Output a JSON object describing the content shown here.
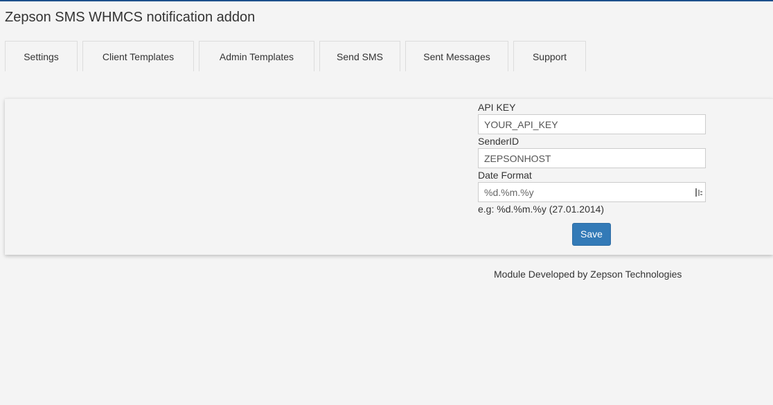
{
  "page": {
    "title": "Zepson SMS WHMCS notification addon"
  },
  "tabs": [
    {
      "label": "Settings"
    },
    {
      "label": "Client Templates"
    },
    {
      "label": "Admin Templates"
    },
    {
      "label": "Send SMS"
    },
    {
      "label": "Sent Messages"
    },
    {
      "label": "Support"
    }
  ],
  "form": {
    "api_key": {
      "label": "API KEY",
      "value": "YOUR_API_KEY"
    },
    "sender_id": {
      "label": "SenderID",
      "value": "ZEPSONHOST"
    },
    "date_format": {
      "label": "Date Format",
      "value": "%d.%m.%y",
      "icon": "input-format-icon"
    },
    "hint": "e.g: %d.%m.%y (27.01.2014)",
    "save_label": "Save"
  },
  "footer": {
    "text": "Module Developed by Zepson Technologies"
  },
  "colors": {
    "accent": "#337ab7",
    "top_bar": "#1c4f8c",
    "background": "#f4f4f4"
  }
}
